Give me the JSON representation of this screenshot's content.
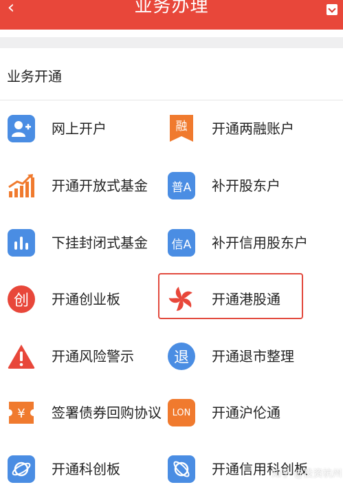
{
  "header": {
    "title": "业务办理",
    "back": "‹"
  },
  "section": {
    "title": "业务开通"
  },
  "colors": {
    "red": "#e8473a",
    "blue": "#4a8de3",
    "orange": "#f07a2e"
  },
  "items": [
    {
      "label": "网上开户",
      "icon": "add-user-icon"
    },
    {
      "label": "开通两融账户",
      "icon": "rong-bookmark-icon",
      "glyph": "融"
    },
    {
      "label": "开通开放式基金",
      "icon": "growth-chart-icon"
    },
    {
      "label": "补开股东户",
      "icon": "pu-a-icon",
      "glyph": "普A"
    },
    {
      "label": "下挂封闭式基金",
      "icon": "bar-chart-icon"
    },
    {
      "label": "补开信用股东户",
      "icon": "xin-a-icon",
      "glyph": "信A"
    },
    {
      "label": "开通创业板",
      "icon": "chuang-icon",
      "glyph": "创"
    },
    {
      "label": "开通港股通",
      "icon": "bauhinia-flower-icon"
    },
    {
      "label": "开通风险警示",
      "icon": "warning-icon",
      "glyph": "!"
    },
    {
      "label": "开通退市整理",
      "icon": "tui-icon",
      "glyph": "退"
    },
    {
      "label": "签署债券回购协议",
      "icon": "yen-ticket-icon",
      "glyph": "¥"
    },
    {
      "label": "开通沪伦通",
      "icon": "lon-icon",
      "glyph": "LON"
    },
    {
      "label": "开通科创板",
      "icon": "planet-icon"
    },
    {
      "label": "开通信用科创板",
      "icon": "planet-ring-icon"
    }
  ],
  "watermark": "知乎 @投资杭州"
}
